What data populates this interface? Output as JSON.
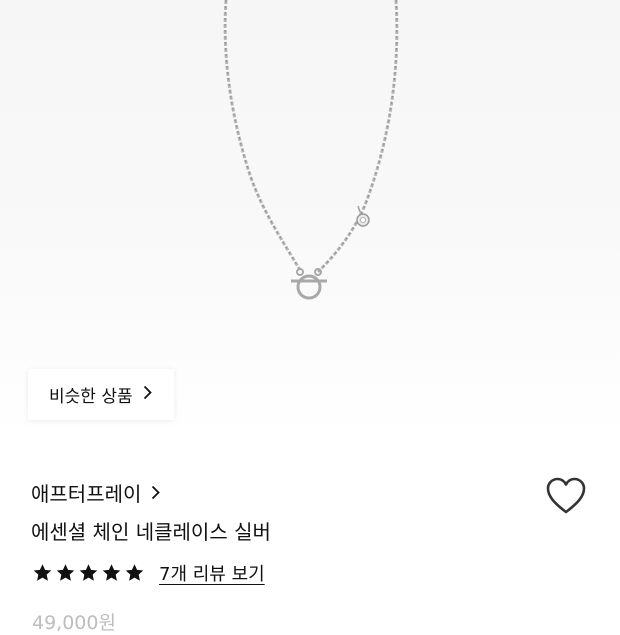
{
  "similar_products": {
    "label": "비슷한 상품",
    "icon": "chevron-right-icon"
  },
  "product": {
    "brand": "애프터프레이",
    "brand_icon": "chevron-right-icon",
    "name": "에센셜 체인 네클레이스 실버",
    "wishlist_icon": "heart-outline-icon",
    "rating_stars": 5,
    "review_link": "7개 리뷰 보기",
    "price": "49,000원"
  },
  "colors": {
    "star": "#111111",
    "price": "#bdbdbd",
    "chain": "#b8b8b8"
  }
}
